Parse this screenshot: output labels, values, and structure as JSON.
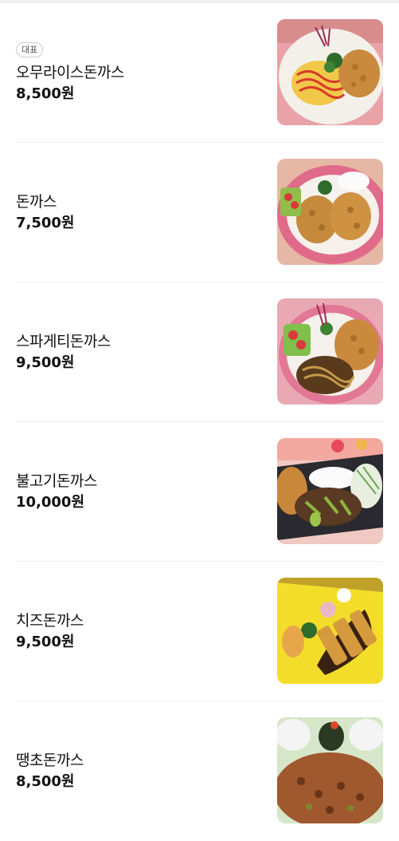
{
  "menu": {
    "items": [
      {
        "badge": "대표",
        "name": "오무라이스돈까스",
        "price": "8,500원"
      },
      {
        "badge": "",
        "name": "돈까스",
        "price": "7,500원"
      },
      {
        "badge": "",
        "name": "스파게티돈까스",
        "price": "9,500원"
      },
      {
        "badge": "",
        "name": "불고기돈까스",
        "price": "10,000원"
      },
      {
        "badge": "",
        "name": "치즈돈까스",
        "price": "9,500원"
      },
      {
        "badge": "",
        "name": "땡초돈까스",
        "price": "8,500원"
      }
    ]
  }
}
